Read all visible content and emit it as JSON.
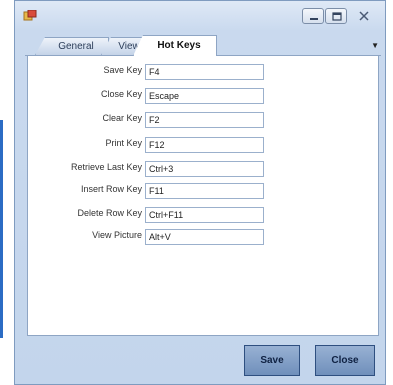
{
  "window": {
    "title": ""
  },
  "tabs": [
    {
      "label": "General",
      "active": false
    },
    {
      "label": "View",
      "active": false
    },
    {
      "label": "Hot Keys",
      "active": true
    }
  ],
  "form": {
    "fields": [
      {
        "label": "Save Key",
        "value": "F4"
      },
      {
        "label": "Close Key",
        "value": "Escape"
      },
      {
        "label": "Clear Key",
        "value": "F2"
      },
      {
        "label": "Print Key",
        "value": "F12"
      },
      {
        "label": "Retrieve Last  Key",
        "value": "Ctrl+3"
      },
      {
        "label": "Insert Row Key",
        "value": "F11"
      },
      {
        "label": "Delete Row Key",
        "value": "Ctrl+F11"
      },
      {
        "label": "View Picture",
        "value": "Alt+V"
      }
    ]
  },
  "buttons": {
    "save": "Save",
    "close": "Close"
  },
  "colors": {
    "window_bg": "#c9d9ee",
    "button_bg": "#7f9dc6",
    "accent": "#2b6cc4"
  },
  "icons": {
    "app": "app-icon",
    "minimize": "minimize-icon",
    "maximize": "maximize-icon",
    "close": "close-icon",
    "tab_menu": "chevron-down-icon"
  }
}
